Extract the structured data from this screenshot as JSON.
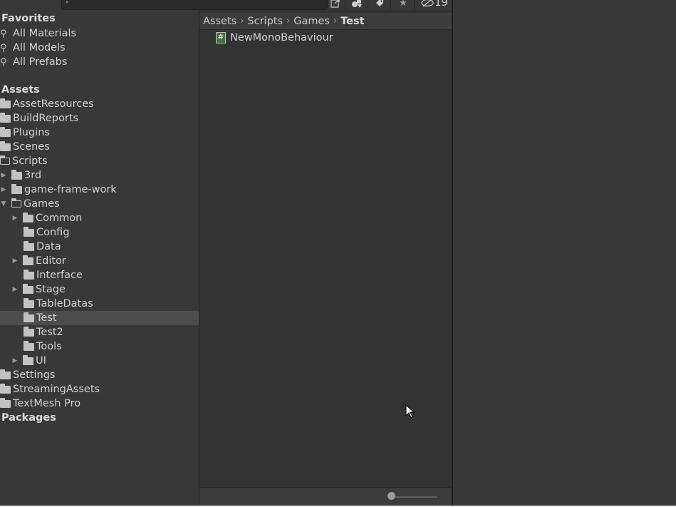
{
  "toolbar": {
    "search_icon": "search-icon",
    "buttons": [
      "open-in-window-icon",
      "layers-icon",
      "tag-icon",
      "star-icon"
    ],
    "hidden_count_icon": "eye-slash-icon",
    "hidden_count": "19"
  },
  "tree": {
    "favorites": {
      "label": "Favorites",
      "items": [
        "All Materials",
        "All Models",
        "All Prefabs"
      ]
    },
    "assets_label": "Assets",
    "asset_folders": [
      "AssetResources",
      "BuildReports",
      "Plugins",
      "Scenes"
    ],
    "scripts": {
      "label": "Scripts",
      "children": [
        "3rd",
        "game-frame-work"
      ]
    },
    "games": {
      "label": "Games",
      "children": [
        "Common",
        "Config",
        "Data",
        "Editor",
        "Interface",
        "Stage",
        "TableDatas",
        "Test",
        "Test2",
        "Tools",
        "UI"
      ],
      "selected": "Test"
    },
    "after_scripts": [
      "Settings",
      "StreamingAssets",
      "TextMesh Pro"
    ],
    "packages_label": "Packages"
  },
  "breadcrumb": [
    "Assets",
    "Scripts",
    "Games",
    "Test"
  ],
  "assets": [
    {
      "name": "NewMonoBehaviour",
      "icon": "csharp-script-icon",
      "glyph": "#"
    }
  ],
  "colors": {
    "panel": "#383838",
    "content": "#333333",
    "selection": "#4d4d4d"
  }
}
